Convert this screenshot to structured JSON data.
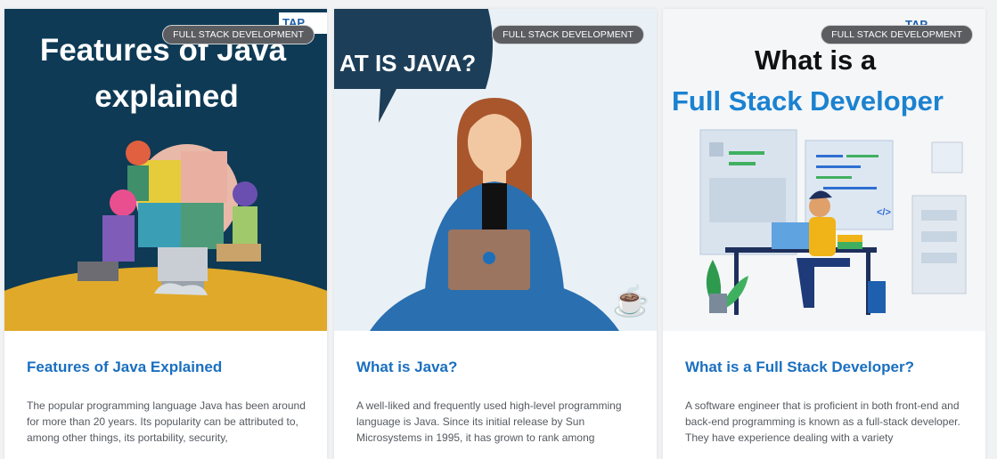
{
  "cards": [
    {
      "badge": "FULL STACK DEVELOPMENT",
      "image_heading_line1": "Features of Java",
      "image_heading_line2": "explained",
      "image_logo": "TAP",
      "title": "Features of Java Explained",
      "excerpt": "The popular programming language Java has been around for more than 20 years. Its popularity can be attributed to, among other things, its portability, security,"
    },
    {
      "badge": "FULL STACK DEVELOPMENT",
      "image_bubble_text": "AT IS JAVA?",
      "title": "What is Java?",
      "excerpt": "A well-liked and frequently used high-level programming language is Java. Since its initial release by Sun Microsystems in 1995, it has grown to rank among"
    },
    {
      "badge": "FULL STACK DEVELOPMENT",
      "image_heading_line1": "What is a",
      "image_heading_line2": "Full Stack Developer",
      "image_logo": "TAP",
      "image_code_tag": "</>",
      "title": "What is a Full Stack Developer?",
      "excerpt": "A software engineer that is proficient in both front-end and back-end programming is known as a full-stack developer. They have experience dealing with a variety"
    }
  ],
  "colors": {
    "title": "#1a6fc0",
    "badge_bg": "#5b5d61",
    "card1_bg": "#0e3a55",
    "card2_bubble": "#1d3e58",
    "card3_heading_blue": "#1b82d0"
  }
}
